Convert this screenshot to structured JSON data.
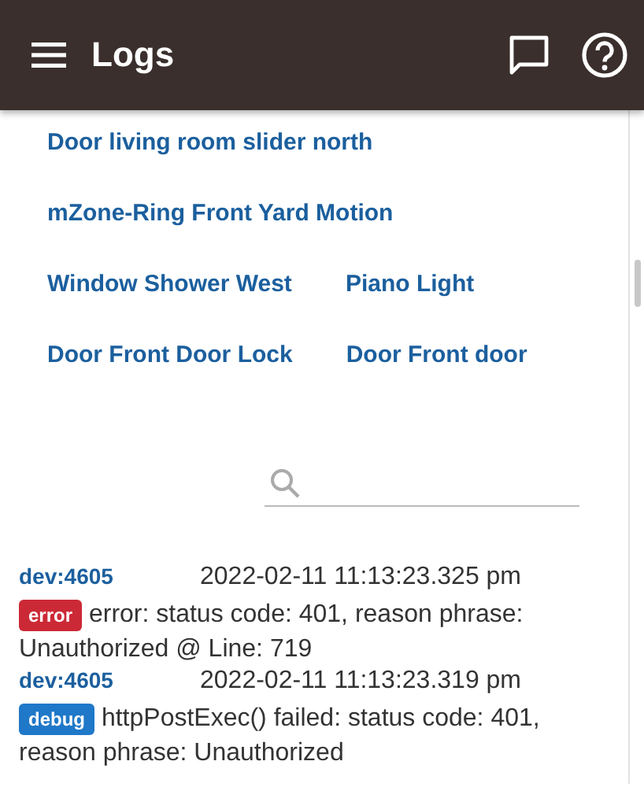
{
  "app_bar": {
    "title": "Logs"
  },
  "device_links": [
    [
      "Door living room slider north"
    ],
    [
      "mZone-Ring Front Yard Motion"
    ],
    [
      "Window Shower West",
      "Piano Light"
    ],
    [
      "Door Front Door Lock",
      "Door Front door"
    ]
  ],
  "logs": [
    {
      "source": "dev:4605",
      "time": "2022-02-11 11:13:23.325 pm",
      "level": "error",
      "message": "error: status code: 401, reason phrase: Unauthorized @ Line: 719"
    },
    {
      "source": "dev:4605",
      "time": "2022-02-11 11:13:23.319 pm",
      "level": "debug",
      "message": "httpPostExec() failed: status code: 401, reason phrase: Unauthorized"
    }
  ]
}
